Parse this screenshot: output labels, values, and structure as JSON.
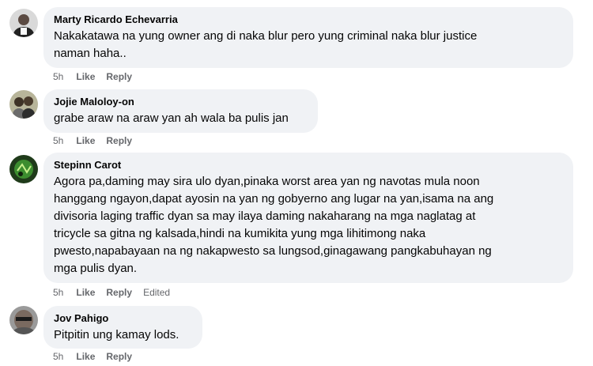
{
  "comments": [
    {
      "author": "Marty Ricardo Echevarria",
      "line1": "Nakakatawa na yung owner ang di naka blur pero yung criminal naka blur justice",
      "line2": "naman haha..",
      "time": "5h",
      "like": "Like",
      "reply": "Reply"
    },
    {
      "author": "Jojie Maloloy-on",
      "line1": "grabe araw na araw yan ah wala ba pulis jan",
      "time": "5h",
      "like": "Like",
      "reply": "Reply"
    },
    {
      "author": "Stepinn Carot",
      "line1": "Agora pa,daming may sira ulo dyan,pinaka worst area yan ng navotas mula noon",
      "line2": "hanggang ngayon,dapat ayosin na yan ng gobyerno ang lugar na yan,isama na ang",
      "line3": "divisoria laging traffic dyan sa may ilaya daming nakaharang na mga naglatag at",
      "line4": "tricycle sa gitna ng kalsada,hindi na kumikita yung mga lihitimong naka",
      "line5": "pwesto,napabayaan na ng nakapwesto sa lungsod,ginagawang pangkabuhayan ng",
      "line6": "mga pulis dyan.",
      "time": "5h",
      "like": "Like",
      "reply": "Reply",
      "edited": "Edited"
    },
    {
      "author": "Jov Pahigo",
      "line1": "Pitpitin ung kamay lods.",
      "time": "5h",
      "like": "Like",
      "reply": "Reply"
    }
  ],
  "colors": {
    "bubble": "#f0f2f5",
    "meta": "#65676b",
    "text": "#050505"
  }
}
